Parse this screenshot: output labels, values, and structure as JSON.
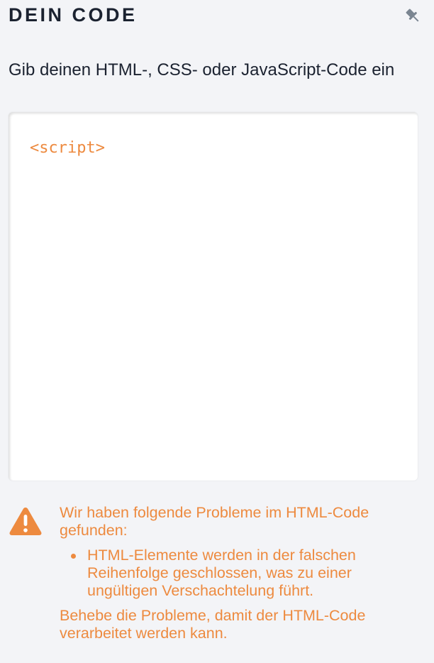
{
  "panel": {
    "title": "DEIN CODE",
    "pin_icon": "pin-icon"
  },
  "editor": {
    "label": "Gib deinen HTML-, CSS- oder JavaScript-Code ein",
    "lines": [
      "<script>"
    ]
  },
  "warning": {
    "icon": "warning-triangle-icon",
    "intro": "Wir haben folgende Probleme im HTML-Code gefunden:",
    "issues": [
      "HTML-Elemente werden in der falschen Reihenfolge geschlossen, was zu einer ungültigen Verschachtelung führt."
    ],
    "footer": "Behebe die Probleme, damit der HTML-Code verarbeitet werden kann."
  },
  "colors": {
    "background": "#f3f4f7",
    "text": "#1b2230",
    "accent": "#ed8a3f",
    "icon_gray": "#7a8591"
  }
}
